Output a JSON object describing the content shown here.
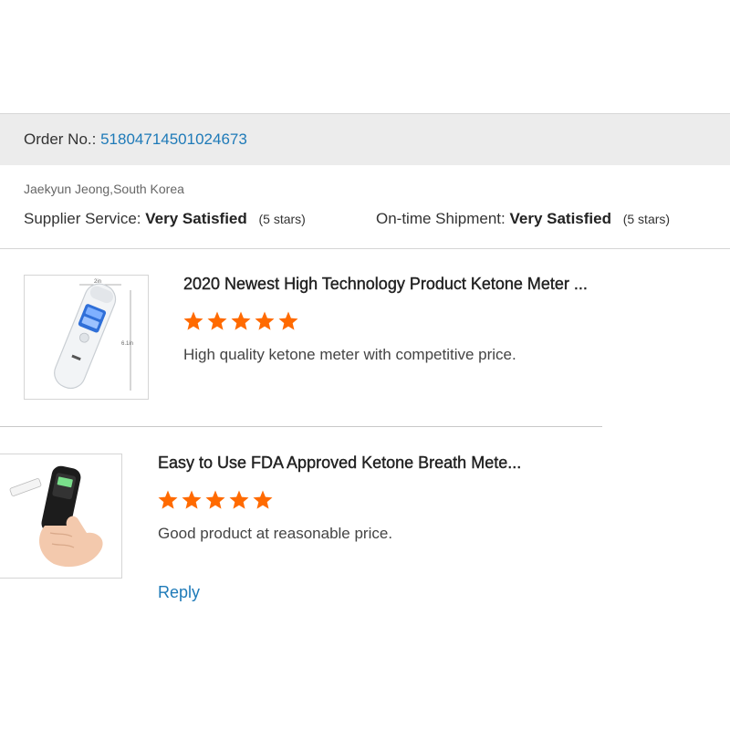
{
  "order": {
    "label": "Order No.:",
    "number": "51804714501024673"
  },
  "buyer": {
    "name": "Jaekyun Jeong,South Korea"
  },
  "ratings": {
    "supplier": {
      "label": "Supplier Service:",
      "value": "Very Satisfied",
      "stars_text": "(5 stars)",
      "stars": 5
    },
    "shipment": {
      "label": "On-time Shipment:",
      "value": "Very Satisfied",
      "stars_text": "(5 stars)",
      "stars": 5
    }
  },
  "reviews": [
    {
      "title": "2020 Newest High Technology Product Ketone Meter ...",
      "rating": 5,
      "text": "High quality ketone meter with competitive price.",
      "image_labels": {
        "width": "2in",
        "height": "6.1in"
      }
    },
    {
      "title": "Easy to Use FDA Approved Ketone Breath Mete...",
      "rating": 5,
      "text": "Good product at reasonable price."
    }
  ],
  "actions": {
    "reply_label": "Reply"
  },
  "colors": {
    "star": "#ff6a00",
    "link": "#1e7ab8",
    "header_bg": "#ececec"
  },
  "icons": {
    "star": "star-icon"
  }
}
